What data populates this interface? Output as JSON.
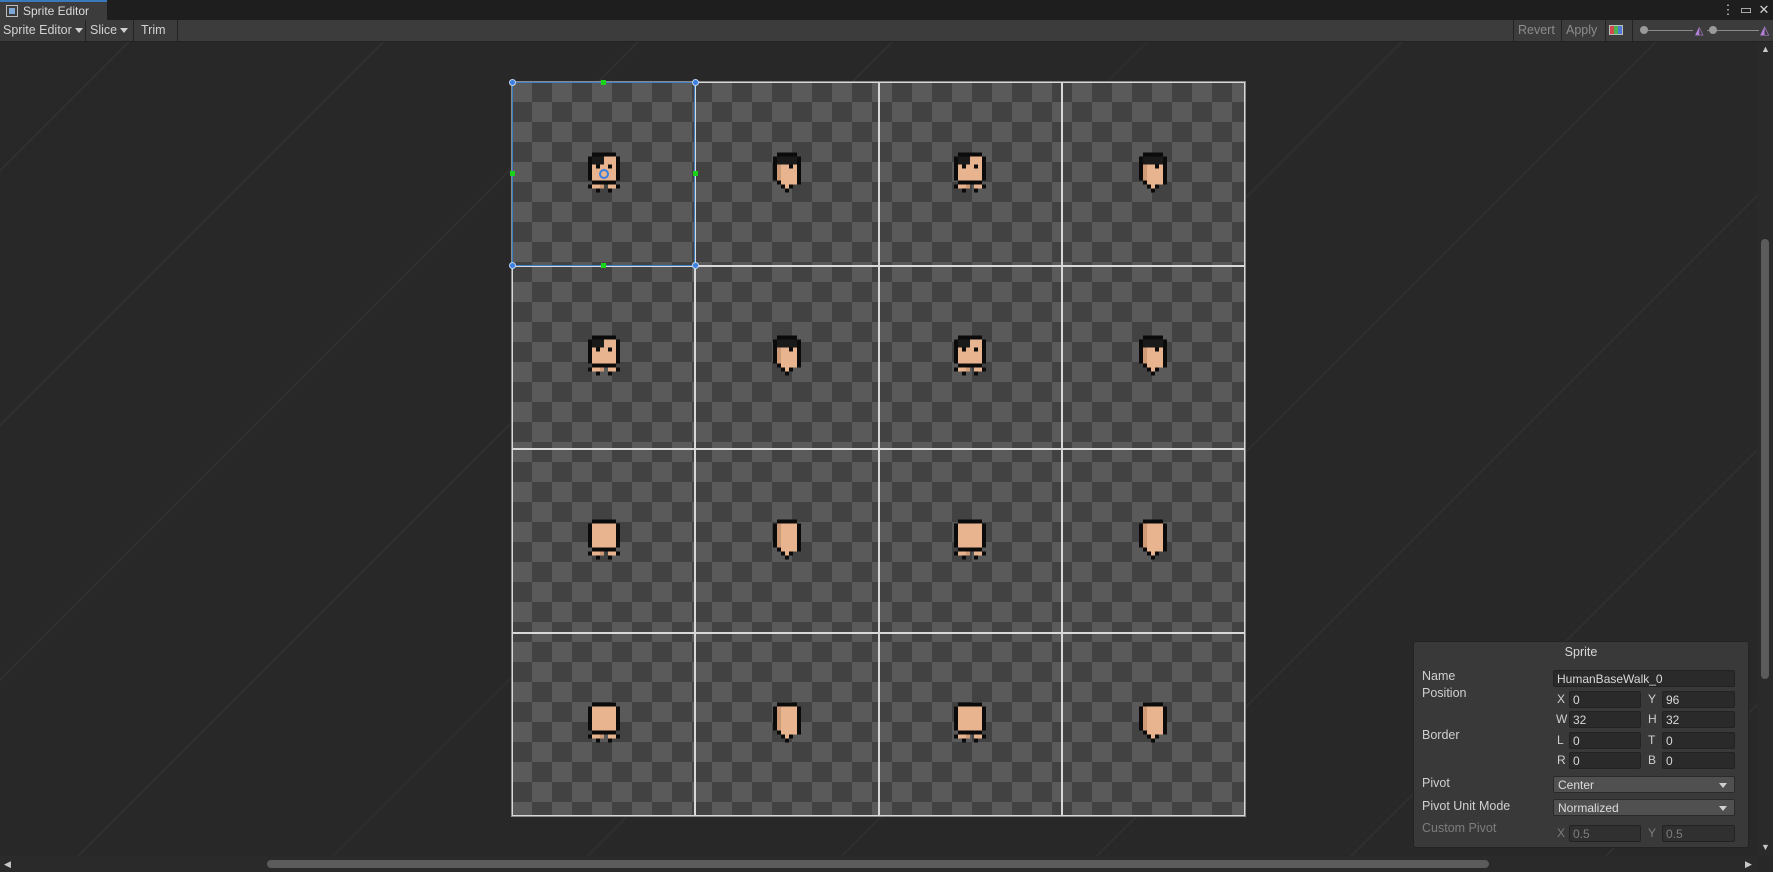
{
  "window": {
    "tab_title": "Sprite Editor",
    "menu_icon": "kebab-menu-icon",
    "maximize_icon": "maximize-icon",
    "close_icon": "close-icon"
  },
  "toolbar": {
    "mode_label": "Sprite Editor",
    "slice_label": "Slice",
    "trim_label": "Trim",
    "revert_label": "Revert",
    "apply_label": "Apply",
    "color_channel_icon": "rgb-channels-icon",
    "zoom_slider_icon": "zoom-slider-icon",
    "mip_icon": "mipmap-icon"
  },
  "sheet": {
    "rows": 4,
    "cols": 4,
    "selected_index": 0
  },
  "inspector": {
    "title": "Sprite",
    "name_label": "Name",
    "name_value": "HumanBaseWalk_0",
    "position_label": "Position",
    "x_label": "X",
    "x_value": "0",
    "y_label": "Y",
    "y_value": "96",
    "w_label": "W",
    "w_value": "32",
    "h_label": "H",
    "h_value": "32",
    "border_label": "Border",
    "l_label": "L",
    "l_value": "0",
    "t_label": "T",
    "t_value": "0",
    "r_label": "R",
    "r_value": "0",
    "b_label": "B",
    "b_value": "0",
    "pivot_label": "Pivot",
    "pivot_value": "Center",
    "pivot_unit_label": "Pivot Unit Mode",
    "pivot_unit_value": "Normalized",
    "custom_pivot_label": "Custom Pivot",
    "cp_x_label": "X",
    "cp_x_value": "0.5",
    "cp_y_label": "Y",
    "cp_y_value": "0.5"
  },
  "colors": {
    "selection": "#3f7fc6",
    "grid_line": "#d8d8d8",
    "skin": "#e8b48f",
    "outline": "#0b0b0b"
  }
}
